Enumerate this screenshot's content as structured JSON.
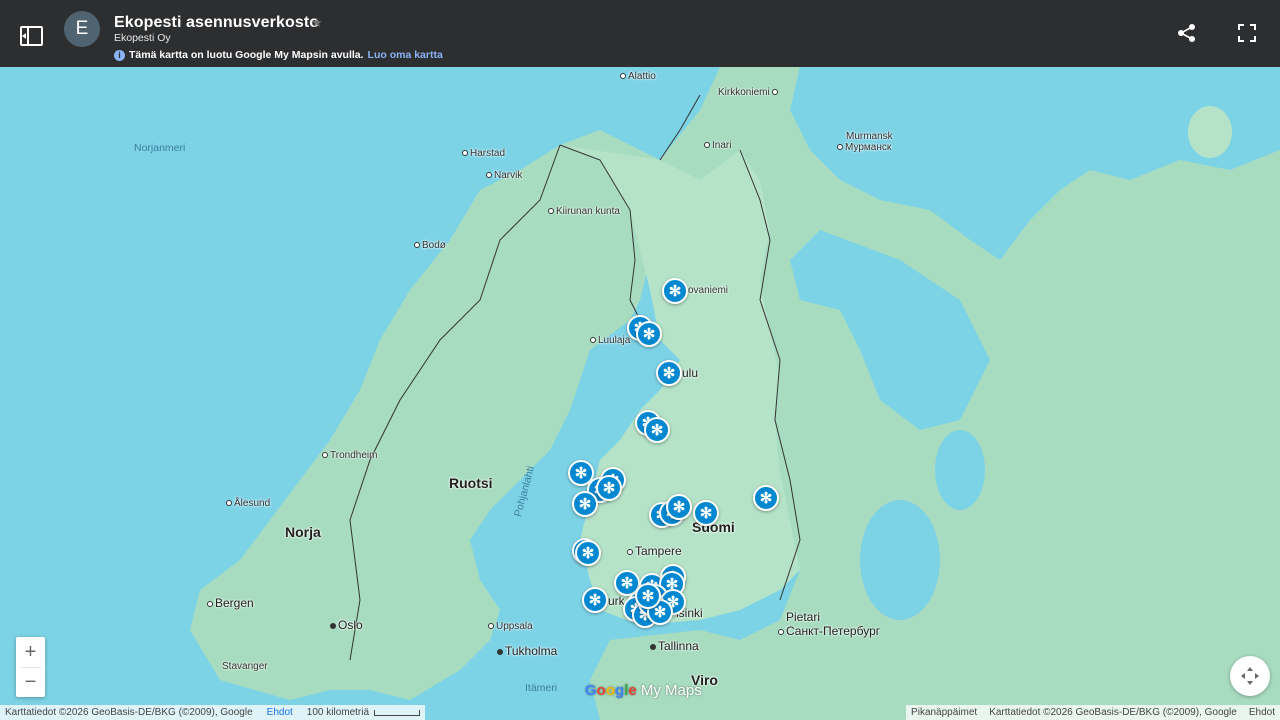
{
  "header": {
    "avatar_letter": "E",
    "title": "Ekopesti asennusverkosto",
    "subtitle": "Ekopesti Oy",
    "info_icon": "i",
    "info_text": "Tämä kartta on luotu Google My Mapsin avulla.",
    "info_link": "Luo oma kartta",
    "icons": [
      "sidebar-toggle-icon",
      "star-icon",
      "info-icon",
      "share-icon",
      "fullscreen-icon"
    ]
  },
  "map": {
    "labels": {
      "norjanmeri": "Norjanmeri",
      "alattio": "Alattio",
      "kirkkoniemi": "Kirkkoniemi",
      "inari": "Inari",
      "murmansk": "Murmansk",
      "murmansk_ru": "Мурманск",
      "harstad": "Harstad",
      "narvik": "Narvik",
      "kiiruna": "Kiirunan kunta",
      "bodo": "Bodø",
      "rovaniemi": "ovaniemi",
      "lulea": "Luulaja",
      "oulu": "ulu",
      "trondheim": "Trondheim",
      "ruotsi": "Ruotsi",
      "alesund": "Ålesund",
      "norja": "Norja",
      "pohjanlahti": "Pohjanlahti",
      "suomi": "Suomi",
      "tampere": "Tampere",
      "turku": "urk",
      "helsinki": "lsinki",
      "bergen": "Bergen",
      "oslo": "Oslo",
      "uppsala": "Uppsala",
      "tukholma": "Tukholma",
      "tallinna": "Tallinna",
      "pietari": "Pietari",
      "pietari_ru": "Санкт-Петербург",
      "stavanger": "Stavanger",
      "itameri": "Itämeri",
      "viro": "Viro"
    },
    "marker_icon": "snowflake-icon",
    "marker_glyph": "✻",
    "marker_color": "#0288d1",
    "marker_count": 31
  },
  "controls": {
    "zoom_in": "+",
    "zoom_out": "−",
    "locate_icon": "recenter-icon"
  },
  "logo": {
    "g": "G",
    "o1": "o",
    "o2": "o",
    "g2": "g",
    "l": "l",
    "e": "e",
    "my_maps": " My Maps"
  },
  "footer": {
    "left_attribution": "Karttatiedot ©2026 GeoBasis-DE/BKG (©2009), Google",
    "left_terms": "Ehdot",
    "scale": "100 kilometriä",
    "shortcuts": "Pikanäppäimet",
    "right_attribution": "Karttatiedot ©2026 GeoBasis-DE/BKG (©2009), Google",
    "right_terms": "Ehdot"
  },
  "colors": {
    "topbar": "#2d2e30",
    "water": "#7dd3e6",
    "land": "#a8dcc0",
    "link": "#8ab4f8"
  }
}
